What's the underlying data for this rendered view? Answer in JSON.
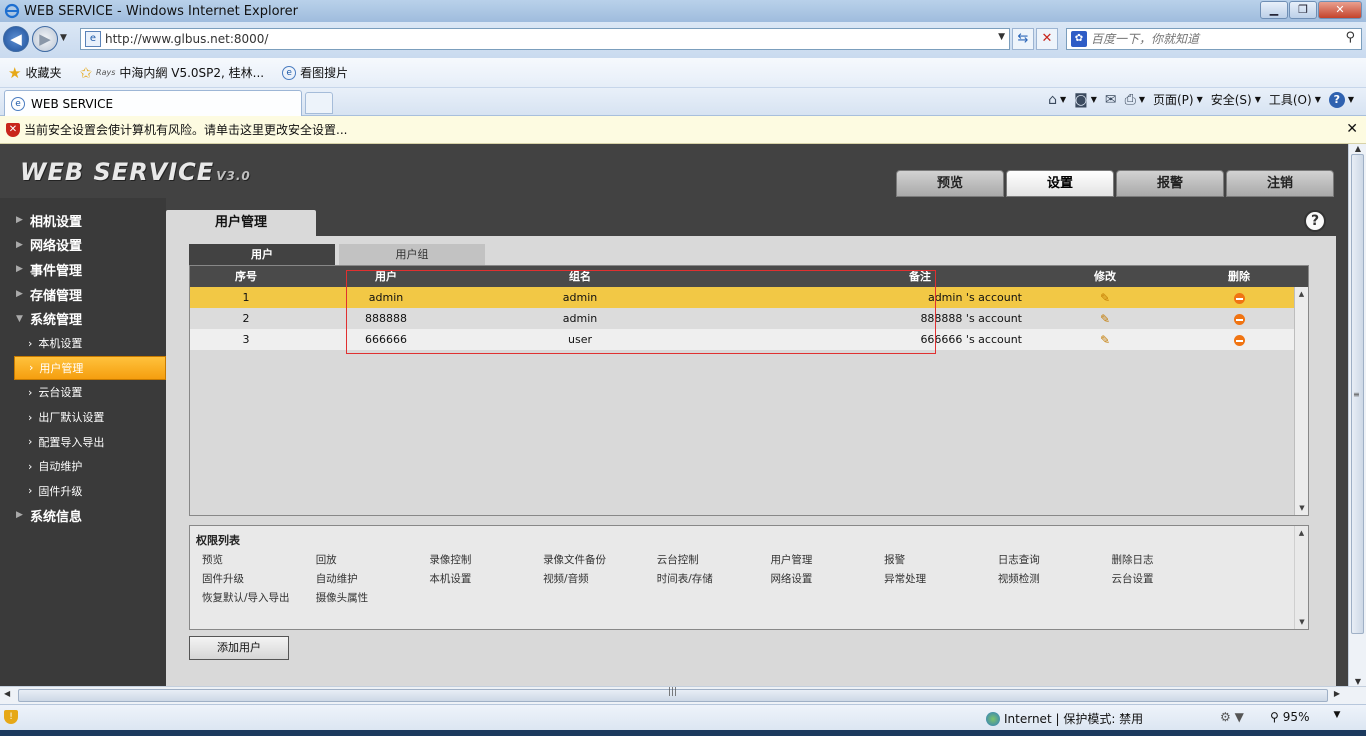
{
  "browser": {
    "window_title": "WEB SERVICE - Windows Internet Explorer",
    "url": "http://www.glbus.net:8000/",
    "search_placeholder": "百度一下，你就知道",
    "favorites": [
      {
        "label": "收藏夹",
        "icon": "star-icon"
      },
      {
        "label": "中海内網 V5.0SP2, 桂林...",
        "icon": "favorites-add-icon",
        "prefix": "Rays"
      },
      {
        "label": "看图搜片",
        "icon": "ie-page-icon"
      }
    ],
    "tab_title": "WEB SERVICE",
    "commands": {
      "page": "页面(P)",
      "safety": "安全(S)",
      "tools": "工具(O)"
    },
    "infobar_message": "当前安全设置会使计算机有风险。请单击这里更改安全设置...",
    "status": {
      "zone": "Internet | 保护模式: 禁用",
      "zoom": "95%"
    }
  },
  "app": {
    "logo": "WEB  SERVICE",
    "logo_version": "V3.0",
    "topnav": [
      "预览",
      "设置",
      "报警",
      "注销"
    ],
    "topnav_active": "设置",
    "sidebar": {
      "sections": [
        {
          "label": "相机设置"
        },
        {
          "label": "网络设置"
        },
        {
          "label": "事件管理"
        },
        {
          "label": "存储管理"
        },
        {
          "label": "系统管理"
        }
      ],
      "sub_items": [
        {
          "label": "本机设置"
        },
        {
          "label": "用户管理"
        },
        {
          "label": "云台设置"
        },
        {
          "label": "出厂默认设置"
        },
        {
          "label": "配置导入导出"
        },
        {
          "label": "自动维护"
        },
        {
          "label": "固件升级"
        }
      ],
      "last_section": "系统信息",
      "active_sub": "用户管理"
    },
    "page_title": "用户管理",
    "subtabs": {
      "users": "用户",
      "groups": "用户组"
    },
    "table": {
      "headers": [
        "序号",
        "用户",
        "组名",
        "备注",
        "修改",
        "删除"
      ],
      "rows": [
        {
          "no": "1",
          "user": "admin",
          "group": "admin",
          "note": "admin 's account"
        },
        {
          "no": "2",
          "user": "888888",
          "group": "admin",
          "note": "888888 's account"
        },
        {
          "no": "3",
          "user": "666666",
          "group": "user",
          "note": "666666 's account"
        }
      ],
      "selected_row": 1
    },
    "permissions": {
      "title": "权限列表",
      "items": [
        "预览",
        "回放",
        "录像控制",
        "录像文件备份",
        "云台控制",
        "用户管理",
        "报警",
        "日志查询",
        "删除日志",
        "固件升级",
        "自动维护",
        "本机设置",
        "视频/音频",
        "时间表/存储",
        "网络设置",
        "异常处理",
        "视频检测",
        "云台设置",
        "恢复默认/导入导出",
        "摄像头属性"
      ]
    },
    "add_user_button": "添加用户"
  },
  "colors": {
    "selected_row": "#f2c845",
    "active_sidebar": "#f59e0f",
    "app_dark": "#424242",
    "highlight_box": "#e03030"
  }
}
